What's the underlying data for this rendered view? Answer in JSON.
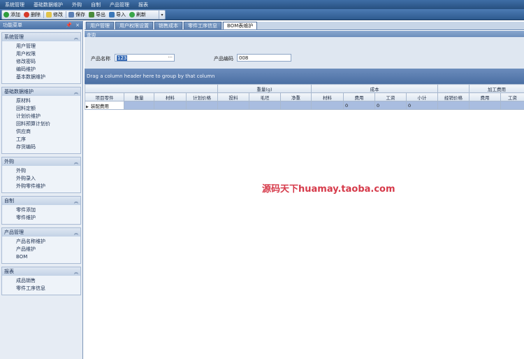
{
  "menubar": [
    "系统管理",
    "基础数据维护",
    "外购",
    "自制",
    "产品管理",
    "报表"
  ],
  "toolbar": {
    "buttons": [
      {
        "label": "添加",
        "icon": "add-icon"
      },
      {
        "label": "删除",
        "icon": "delete-icon"
      },
      {
        "label": "修改",
        "icon": "edit-icon"
      },
      {
        "label": "保存",
        "icon": "save-icon"
      },
      {
        "label": "导出",
        "icon": "export-icon"
      },
      {
        "label": "导入",
        "icon": "import-icon"
      },
      {
        "label": "刷新",
        "icon": "refresh-icon"
      }
    ]
  },
  "sidebar": {
    "title": "功能菜单",
    "pin": "📌",
    "close": "×",
    "groups": [
      {
        "title": "系统管理",
        "items": [
          "用户管理",
          "用户权限",
          "修改密码",
          "编码维护",
          "基本数据维护"
        ]
      },
      {
        "title": "基础数据维护",
        "items": [
          "原材料",
          "回料定额",
          "计划价维护",
          "回料预算计划价",
          "供应商",
          "工序",
          "存货编码"
        ]
      },
      {
        "title": "外购",
        "items": [
          "外购",
          "外购录入",
          "外购零件维护"
        ]
      },
      {
        "title": "自制",
        "items": [
          "零件添加",
          "零件维护"
        ]
      },
      {
        "title": "产品管理",
        "items": [
          "产品名称维护",
          "产品维护",
          "BOM"
        ]
      },
      {
        "title": "报表",
        "items": [
          "成品销售",
          "零件工序信息"
        ]
      }
    ]
  },
  "tabs": [
    "用户管理",
    "用户权限设置",
    "销售成本",
    "零件工序信息",
    "BOM表维护"
  ],
  "active_tab_index": 4,
  "panel": {
    "title": "查询",
    "product_name_label": "产品名称",
    "product_name_value": "123",
    "product_name_ellipsis": "···",
    "product_code_label": "产品编码",
    "product_code_value": "008"
  },
  "grid": {
    "group_hint": "Drag a column header here to group by that column",
    "band_headers": [
      {
        "label": "",
        "span": 4
      },
      {
        "label": "重量(g)",
        "span": 3
      },
      {
        "label": "成本",
        "span": 4
      },
      {
        "label": "",
        "span": 1
      },
      {
        "label": "加工费用",
        "span": 2
      }
    ],
    "columns": [
      "项目零件",
      "数量",
      "材料",
      "计划价格",
      "投料",
      "毛坯",
      "净重",
      "材料",
      "费用",
      "工资",
      "小计",
      "经销价格",
      "费用",
      "工资"
    ],
    "rows": [
      {
        "cells": [
          "装配费用",
          "",
          "",
          "",
          "",
          "",
          "",
          "",
          "0",
          "0",
          "0",
          "",
          "",
          ""
        ]
      }
    ]
  },
  "watermark": "源码天下huamay.taoba.com"
}
